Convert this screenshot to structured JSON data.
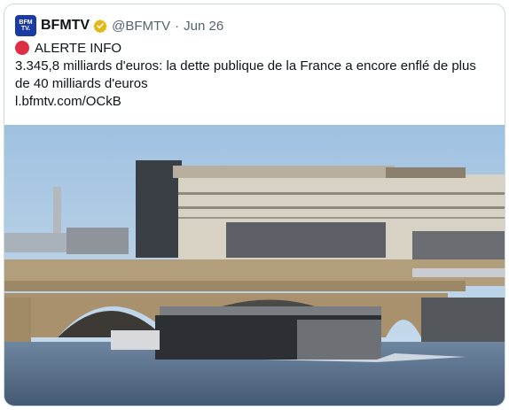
{
  "tweet": {
    "author_name": "BFMTV",
    "avatar_text": "BFM TV.",
    "handle": "@BFMTV",
    "separator": "·",
    "date": "Jun 26",
    "verified_icon": "gold-verified-check-icon",
    "alert_icon": "red-circle-icon",
    "alert_label": "ALERTE INFO",
    "text_line1": "3.345,8 milliards d'euros: la dette publique de la France a encore enflé de plus",
    "text_line2": "de 40 milliards d'euros",
    "link": "l.bfmtv.com/OCkB"
  },
  "colors": {
    "verified_gold": "#e2b719",
    "alert_red": "#dd2e44",
    "avatar_blue": "#1c3aa3",
    "text": "#0f1419",
    "muted": "#536471"
  }
}
